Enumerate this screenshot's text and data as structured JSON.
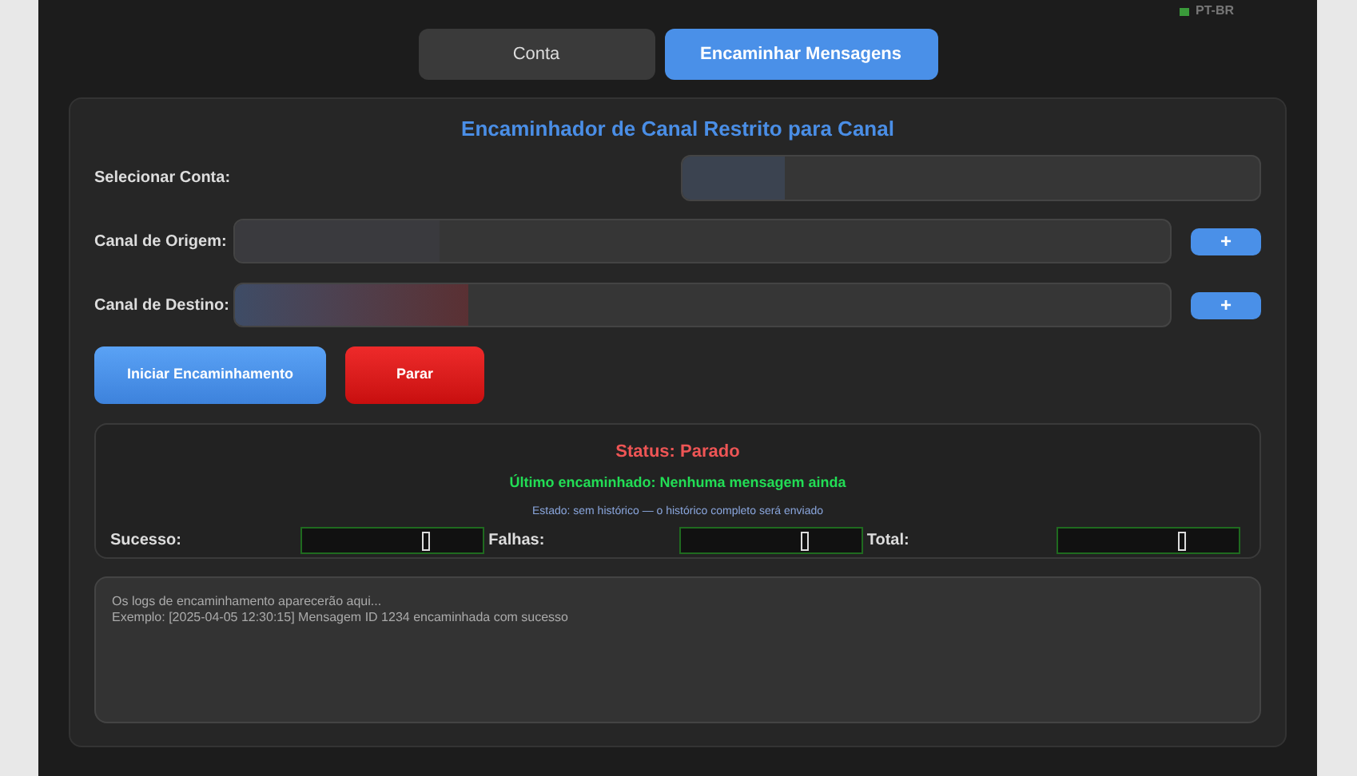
{
  "language": "PT-BR",
  "tabs": [
    {
      "label": "Conta",
      "selected": false
    },
    {
      "label": "Encaminhar Mensagens",
      "selected": true
    }
  ],
  "title": "Encaminhador de Canal Restrito para Canal",
  "fields": [
    {
      "label": "Selecionar Conta:",
      "kind": "select"
    },
    {
      "label": "Canal de Origem:",
      "kind": "add",
      "button": "+"
    },
    {
      "label": "Canal de Destino:",
      "kind": "add",
      "button": "+"
    }
  ],
  "actions": [
    {
      "label": "Iniciar Encaminhamento",
      "kind": "start"
    },
    {
      "label": "Parar",
      "kind": "stop"
    }
  ],
  "status": {
    "text": "Status: Parado",
    "last": "Último encaminhado: Nenhuma mensagem ainda",
    "state": "Estado: sem histórico — o histórico completo será enviado"
  },
  "counters": [
    {
      "label": "Sucesso:"
    },
    {
      "label": "Falhas:"
    },
    {
      "label": "Total:"
    }
  ],
  "log": {
    "placeholder": "Os logs de encaminhamento aparecerão aqui...\nExemplo: [2025-04-05 12:30:15] Mensagem ID 1234 encaminhada com sucesso"
  }
}
